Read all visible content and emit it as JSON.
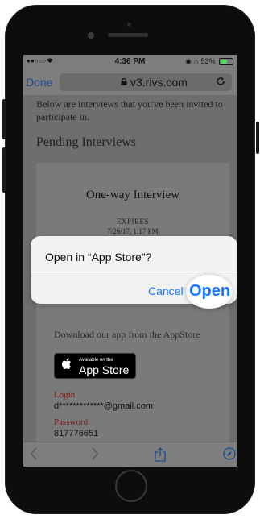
{
  "status_bar": {
    "carrier": "●●○○○ ",
    "time": "4:36 PM",
    "indicators": "◉ ∩ 53%",
    "battery_level": 0.53
  },
  "url_bar": {
    "done_label": "Done",
    "url": "v3.rivs.com",
    "lock_icon": "lock-icon",
    "reload_icon": "reload-icon"
  },
  "page": {
    "intro_text": "Below are interviews that you've been invited to participate in.",
    "section_title": "Pending Interviews",
    "card": {
      "title": "One-way Interview",
      "expires_label": "EXPIRES",
      "expires_date": "7/26/17, 1:17 PM",
      "download_text": "Download our app from the AppStore",
      "app_store_badge": {
        "small": "Available on the",
        "big": "App Store"
      },
      "login_label": "Login",
      "login_value": "d*************@gmail.com",
      "password_label": "Password",
      "password_value": "817776651"
    }
  },
  "dialog": {
    "title": "Open in “App Store”?",
    "cancel": "Cancel",
    "open": "Open"
  },
  "toolbar": {
    "icons": [
      "back-icon",
      "forward-icon",
      "share-icon",
      "compass-icon"
    ]
  },
  "colors": {
    "link_blue": "#1678ff",
    "label_red": "#7a1a1a",
    "battery_green": "#4cd964"
  }
}
